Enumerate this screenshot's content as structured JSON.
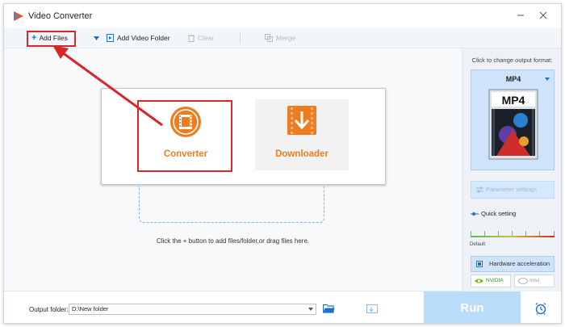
{
  "window": {
    "title": "Video Converter"
  },
  "toolbar": {
    "add_files": "Add Files",
    "add_video_folder": "Add Video Folder",
    "clear": "Clear",
    "merge": "Merge"
  },
  "main": {
    "converter_label": "Converter",
    "downloader_label": "Downloader",
    "hint": "Click the + button to add files/folder,or drag files here."
  },
  "right_panel": {
    "caption": "Click to change output format:",
    "format_name": "MP4",
    "format_icon_text": "MP4",
    "parameter_settings": "Parameter settings",
    "quick_setting": "Quick setting",
    "default_label": "Default",
    "hardware_acceleration": "Hardware acceleration",
    "nvidia": "NVIDIA",
    "intel": "Intel"
  },
  "bottom": {
    "output_folder_label": "Output folder:",
    "output_folder_value": "D:\\New folder",
    "run_label": "Run"
  },
  "colors": {
    "accent_orange": "#ee7d1f",
    "highlight_red": "#d8262b",
    "brand_blue": "#1e6fd0",
    "run_button": "#b9dcfa"
  }
}
